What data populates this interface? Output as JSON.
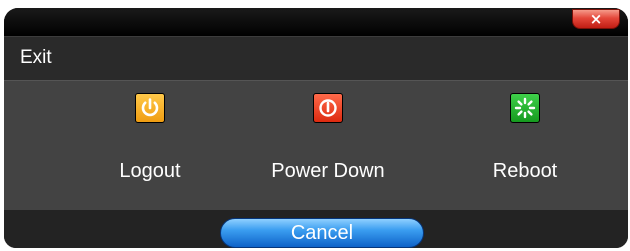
{
  "dialog": {
    "title": "Exit",
    "close_label": "×"
  },
  "options": [
    {
      "label": "Logout",
      "icon": "logout-power-icon",
      "color": "#f5ab1f"
    },
    {
      "label": "Power Down",
      "icon": "power-icon",
      "color": "#e63a1e"
    },
    {
      "label": "Reboot",
      "icon": "reboot-spinner-icon",
      "color": "#2bb536"
    }
  ],
  "footer": {
    "cancel_label": "Cancel"
  }
}
